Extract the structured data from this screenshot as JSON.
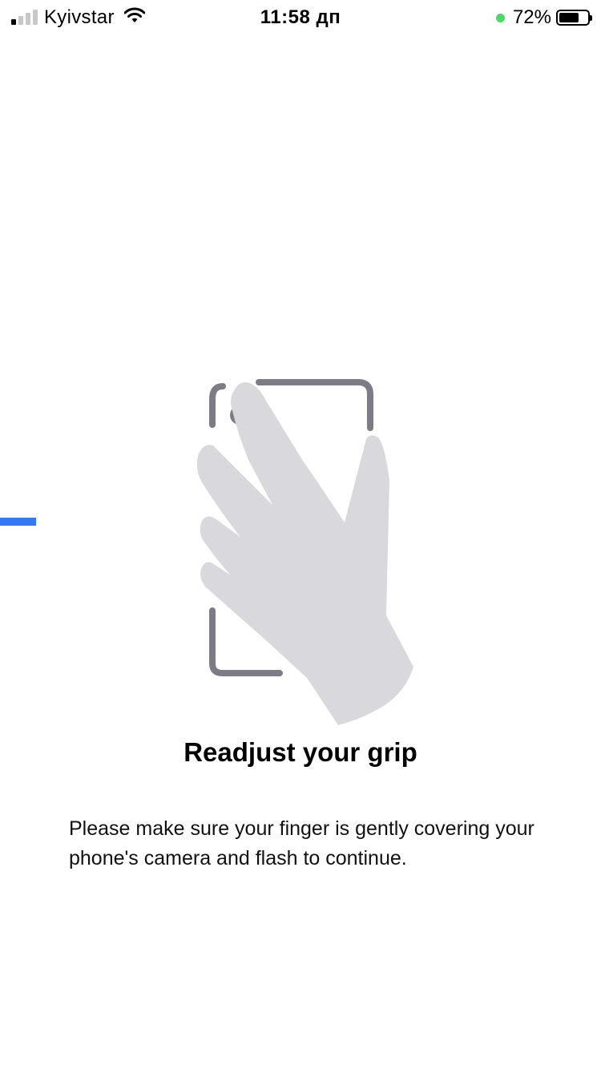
{
  "status_bar": {
    "carrier": "Kyivstar",
    "time": "11:58 дп",
    "battery_percent": "72%",
    "battery_level": 0.72,
    "signal_bars_active": 1,
    "signal_bars_total": 4,
    "icons": [
      "signal-icon",
      "wifi-icon",
      "privacy-dot-icon",
      "battery-icon"
    ]
  },
  "progress": {
    "value": 0.06,
    "color": "#3478f6"
  },
  "illustration": {
    "icon": "hand-on-phone-icon",
    "frame_color": "#7d7c86",
    "hand_color": "#d9d9dd"
  },
  "content": {
    "title": "Readjust your grip",
    "message": "Please make sure your finger is gently covering your phone's camera and flash to continue."
  }
}
